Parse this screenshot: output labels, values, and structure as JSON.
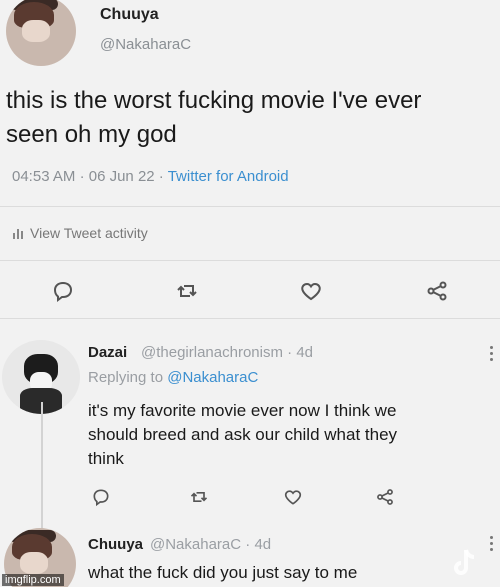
{
  "main_tweet": {
    "display_name": "Chuuya",
    "handle": "@NakaharaC",
    "text_line1": "this is the worst fucking movie I've ever",
    "text_line2": "seen oh my god",
    "time": "04:53 AM",
    "date": "06 Jun 22",
    "source": "Twitter for Android",
    "view_activity": "View Tweet activity"
  },
  "reply1": {
    "display_name": "Dazai",
    "handle": "@thegirlanachronism",
    "age": "4d",
    "replying_label": "Replying to",
    "replying_handle": "@NakaharaC",
    "text_line1": "it's my favorite movie ever now I think we",
    "text_line2": "should breed and ask our child what they",
    "text_line3": "think"
  },
  "reply2": {
    "display_name": "Chuuya",
    "handle": "@NakaharaC",
    "age": "4d",
    "text_line1": "what the fuck did you just say to me"
  },
  "watermark": "imgflip.com",
  "colors": {
    "link": "#3b8fd0",
    "muted": "#8a8f94",
    "background": "#f2f2f2"
  },
  "icons": [
    "reply-icon",
    "retweet-icon",
    "like-icon",
    "share-icon",
    "more-icon",
    "bar-chart-icon",
    "tiktok-logo"
  ]
}
